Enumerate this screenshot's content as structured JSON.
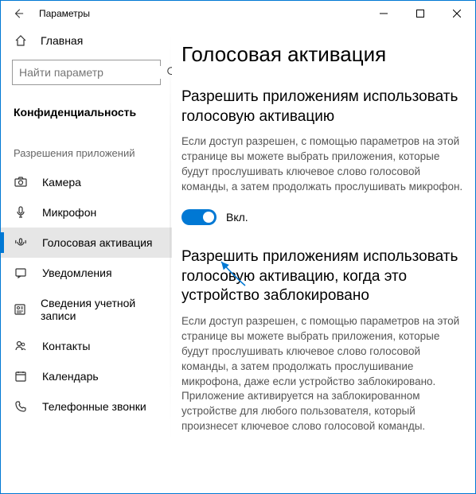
{
  "titlebar": {
    "title": "Параметры"
  },
  "sidebar": {
    "home": "Главная",
    "search_placeholder": "Найти параметр",
    "category": "Конфиденциальность",
    "subheader": "Разрешения приложений",
    "items": [
      {
        "label": "Камера",
        "icon": "camera"
      },
      {
        "label": "Микрофон",
        "icon": "mic"
      },
      {
        "label": "Голосовая активация",
        "icon": "voice",
        "active": true
      },
      {
        "label": "Уведомления",
        "icon": "notif"
      },
      {
        "label": "Сведения учетной записи",
        "icon": "account"
      },
      {
        "label": "Контакты",
        "icon": "contacts"
      },
      {
        "label": "Календарь",
        "icon": "calendar"
      },
      {
        "label": "Телефонные звонки",
        "icon": "phone"
      }
    ]
  },
  "main": {
    "page_title": "Голосовая активация",
    "section1_title": "Разрешить приложениям использовать голосовую активацию",
    "section1_desc": "Если доступ разрешен, с помощью параметров на этой странице вы можете выбрать приложения, которые будут прослушивать ключевое слово голосовой команды, а затем продолжать прослушивать микрофон.",
    "toggle1_state": "Вкл.",
    "section2_title": "Разрешить приложениям использовать голосовую активацию, когда это устройство заблокировано",
    "section2_desc": "Если доступ разрешен, с помощью параметров на этой странице вы можете выбрать приложения, которые будут прослушивать ключевое слово голосовой команды, а затем продолжать прослушивание микрофона, даже если устройство заблокировано. Приложение активируется на заблокированном устройстве для любого пользователя, который произнесет ключевое слово голосовой команды."
  }
}
